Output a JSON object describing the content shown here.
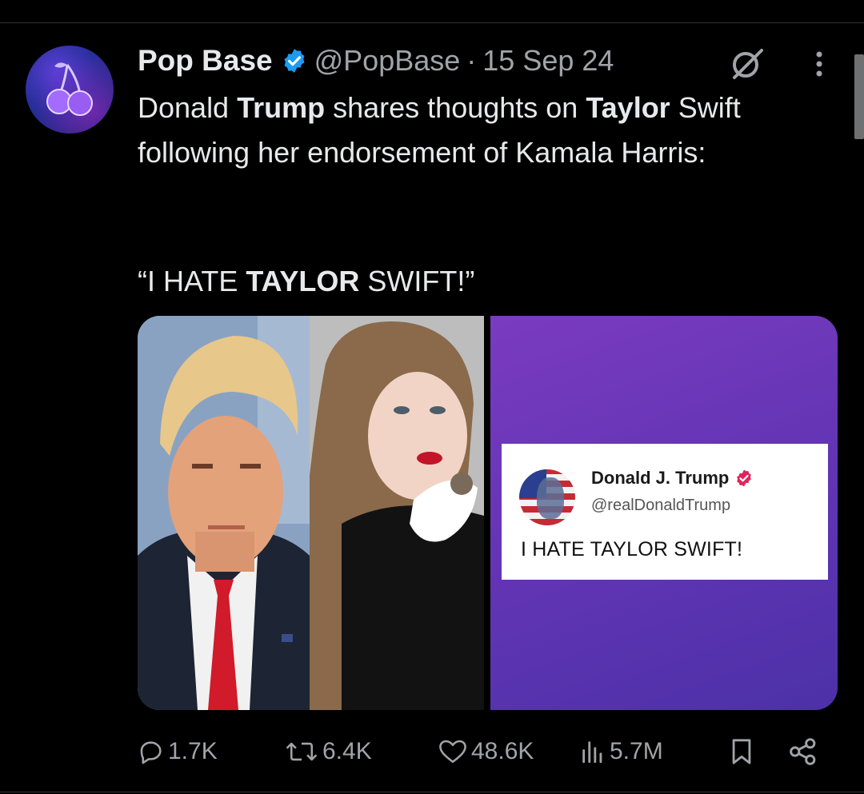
{
  "tweet": {
    "author": {
      "display_name": "Pop Base",
      "handle": "@PopBase",
      "verified": true,
      "avatar_icon": "cherries-logo-icon"
    },
    "separator": "·",
    "date": "15 Sep 24",
    "text": {
      "p1_1": "Donald ",
      "p1_2": "Trump",
      "p1_3": " shares thoughts on ",
      "p1_4": "Taylor",
      "p1_5": " Swift following her endorsement of Kamala Harris:",
      "q_1": "“I HATE ",
      "q_2": "TAYLOR",
      "q_3": " SWIFT!”"
    },
    "media": {
      "embedded_post": {
        "name": "Donald J. Trump",
        "handle": "@realDonaldTrump",
        "text": "I HATE TAYLOR SWIFT!"
      }
    },
    "metrics": {
      "replies": "1.7K",
      "reposts": "6.4K",
      "likes": "48.6K",
      "views": "5.7M"
    }
  },
  "colors": {
    "background": "#000000",
    "text": "#e7e9ea",
    "secondary_text": "#a0a4a8",
    "verified_blue": "#1d9bf0",
    "media_purple": "#6535b6"
  }
}
